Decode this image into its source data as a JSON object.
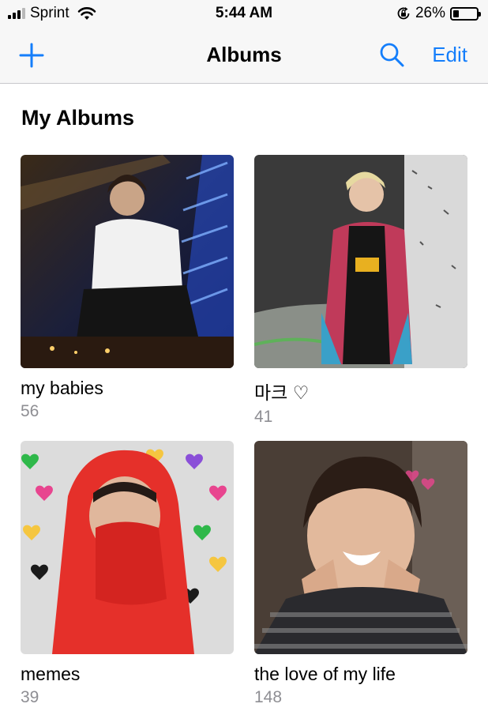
{
  "status_bar": {
    "carrier": "Sprint",
    "time": "5:44 AM",
    "battery_percent": "26%",
    "battery_level": 0.26
  },
  "nav": {
    "title": "Albums",
    "edit_label": "Edit",
    "accent_color": "#147efb"
  },
  "section": {
    "title": "My Albums"
  },
  "albums": [
    {
      "name": "my babies",
      "count": "56"
    },
    {
      "name": "마크 ♡",
      "count": "41"
    },
    {
      "name": "memes",
      "count": "39"
    },
    {
      "name": "the love of my life",
      "count": "148"
    }
  ],
  "icons": {
    "add": "plus-icon",
    "search": "search-icon",
    "wifi": "wifi-icon",
    "rotation_lock": "rotation-lock-icon",
    "battery": "battery-icon"
  }
}
